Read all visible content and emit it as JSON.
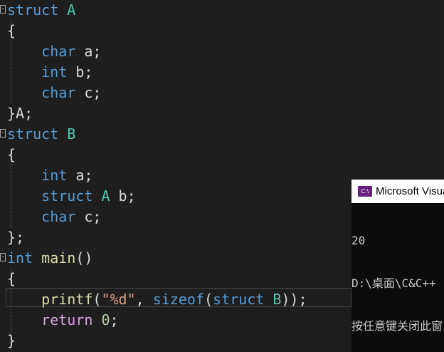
{
  "editor": {
    "lines": [
      {
        "parts": [
          {
            "t": "struct",
            "c": "kw"
          },
          {
            "t": " "
          },
          {
            "t": "A",
            "c": "ty"
          }
        ],
        "fold": true
      },
      {
        "parts": [
          {
            "t": "{"
          }
        ]
      },
      {
        "parts": [
          {
            "t": "    "
          },
          {
            "t": "char",
            "c": "kw"
          },
          {
            "t": " a;"
          }
        ]
      },
      {
        "parts": [
          {
            "t": "    "
          },
          {
            "t": "int",
            "c": "kw"
          },
          {
            "t": " b;"
          }
        ]
      },
      {
        "parts": [
          {
            "t": "    "
          },
          {
            "t": "char",
            "c": "kw"
          },
          {
            "t": " c;"
          }
        ]
      },
      {
        "parts": [
          {
            "t": "}A;"
          }
        ]
      },
      {
        "parts": [
          {
            "t": "struct",
            "c": "kw"
          },
          {
            "t": " "
          },
          {
            "t": "B",
            "c": "ty"
          }
        ],
        "fold": true
      },
      {
        "parts": [
          {
            "t": "{"
          }
        ]
      },
      {
        "parts": [
          {
            "t": "    "
          },
          {
            "t": "int",
            "c": "kw"
          },
          {
            "t": " a;"
          }
        ]
      },
      {
        "parts": [
          {
            "t": "    "
          },
          {
            "t": "struct",
            "c": "kw"
          },
          {
            "t": " "
          },
          {
            "t": "A",
            "c": "ty"
          },
          {
            "t": " b;"
          }
        ]
      },
      {
        "parts": [
          {
            "t": "    "
          },
          {
            "t": "char",
            "c": "kw"
          },
          {
            "t": " c;"
          }
        ]
      },
      {
        "parts": [
          {
            "t": "};"
          }
        ]
      },
      {
        "parts": [
          {
            "t": "int",
            "c": "kw"
          },
          {
            "t": " "
          },
          {
            "t": "main",
            "c": "fn"
          },
          {
            "t": "()"
          }
        ],
        "fold": true
      },
      {
        "parts": [
          {
            "t": "{"
          }
        ]
      },
      {
        "parts": [
          {
            "t": "    "
          },
          {
            "t": "printf",
            "c": "fn"
          },
          {
            "t": "("
          },
          {
            "t": "\"%d\"",
            "c": "str"
          },
          {
            "t": ", "
          },
          {
            "t": "sizeof",
            "c": "kw"
          },
          {
            "t": "("
          },
          {
            "t": "struct",
            "c": "kw"
          },
          {
            "t": " "
          },
          {
            "t": "B",
            "c": "ty"
          },
          {
            "t": "));"
          }
        ]
      },
      {
        "parts": [
          {
            "t": "    "
          },
          {
            "t": "return",
            "c": "ctrl"
          },
          {
            "t": " "
          },
          {
            "t": "0",
            "c": "num"
          },
          {
            "t": ";"
          }
        ]
      },
      {
        "parts": [
          {
            "t": "}"
          }
        ]
      }
    ]
  },
  "console": {
    "icon_label": "C:\\",
    "title": "Microsoft Visual Studio 调试控制台",
    "output": [
      "20",
      "D:\\桌面\\C&C++",
      "按任意键关闭此窗口. . ."
    ]
  }
}
